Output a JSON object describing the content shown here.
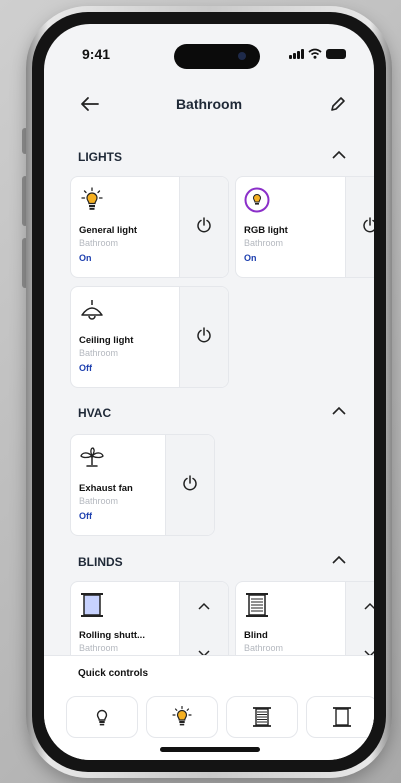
{
  "status_bar": {
    "time": "9:41"
  },
  "header": {
    "title": "Bathroom"
  },
  "sections": {
    "lights": {
      "title": "LIGHTS"
    },
    "hvac": {
      "title": "HVAC"
    },
    "blinds": {
      "title": "BLINDS"
    }
  },
  "lights": [
    {
      "name": "General light",
      "room": "Bathroom",
      "state": "On",
      "icon": "bulb-on-icon"
    },
    {
      "name": "RGB light",
      "room": "Bathroom",
      "state": "On",
      "icon": "rgb-bulb-icon"
    },
    {
      "name": "Ceiling light",
      "room": "Bathroom",
      "state": "Off",
      "icon": "ceiling-lamp-icon"
    }
  ],
  "hvac": [
    {
      "name": "Exhaust fan",
      "room": "Bathroom",
      "state": "Off",
      "icon": "fan-icon"
    }
  ],
  "blinds": [
    {
      "name": "Rolling shutt...",
      "room": "Bathroom",
      "icon": "rolling-shutter-icon"
    },
    {
      "name": "Blind",
      "room": "Bathroom",
      "icon": "blind-icon"
    }
  ],
  "quick_controls": {
    "title": "Quick controls",
    "buttons": [
      "bulb-off-icon",
      "bulb-on-icon",
      "rolling-shutter-icon",
      "blind-icon"
    ]
  },
  "colors": {
    "accent_blue": "#1e40af",
    "bulb_yellow": "#f5b021",
    "rgb_ring": "#8b2fc9"
  }
}
